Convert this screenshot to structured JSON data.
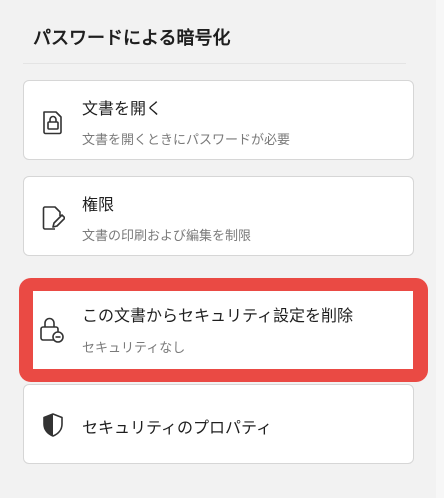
{
  "section": {
    "title": "パスワードによる暗号化"
  },
  "cards": {
    "open": {
      "icon": "lock-document-icon",
      "title": "文書を開く",
      "desc": "文書を開くときにパスワードが必要"
    },
    "permissions": {
      "icon": "edit-document-icon",
      "title": "権限",
      "desc": "文書の印刷および編集を制限"
    },
    "remove_security": {
      "icon": "unlock-remove-icon",
      "title": "この文書からセキュリティ設定を削除",
      "desc": "セキュリティなし"
    },
    "properties": {
      "icon": "shield-icon",
      "title": "セキュリティのプロパティ"
    }
  },
  "colors": {
    "highlight": "#ea4a44",
    "background": "#f2f2f2",
    "card": "#ffffff"
  }
}
